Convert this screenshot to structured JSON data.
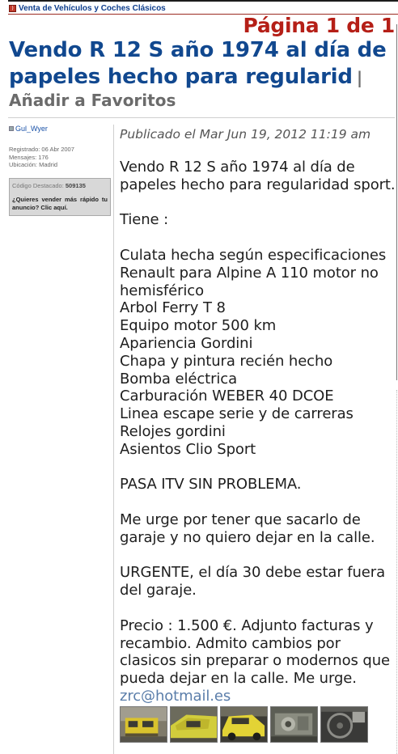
{
  "breadcrumb": {
    "label": "Venta de Vehículos y Coches Clásicos",
    "icon": "rss-icon"
  },
  "pagination": {
    "text": "Página 1 de 1"
  },
  "topic": {
    "title": "Vendo R 12 S año 1974 al día de papeles hecho para regularid",
    "favorite_link": "| Añadir a Favoritos"
  },
  "author": {
    "username": "Gul_Wyer",
    "registered": "Registrado: 06 Abr 2007",
    "posts": "Mensajes: 176",
    "location": "Ubicación: Madrid"
  },
  "promo": {
    "code_label": "Código Destacado:",
    "code_value": "509135",
    "link": "¿Quieres vender más rápido tu anuncio? Clic aquí."
  },
  "post": {
    "date": "Publicado el Mar Jun 19, 2012 11:19 am",
    "intro": "Vendo R 12 S año 1974 al día de papeles hecho para regularidad sport.",
    "tiene": "Tiene :",
    "features": [
      "Culata hecha según especificaciones Renault para Alpine A 110 motor no hemisférico",
      "Arbol Ferry T 8",
      "Equipo motor 500 km",
      "Apariencia Gordini",
      "Chapa y pintura recién hecho",
      "Bomba eléctrica",
      "Carburación WEBER 40 DCOE",
      "Linea escape serie y de carreras",
      "Relojes gordini",
      "Asientos Clio Sport"
    ],
    "itv": "PASA ITV SIN PROBLEMA.",
    "urge": "Me urge por tener que sacarlo de garaje y no quiero dejar en la calle.",
    "urgente": "URGENTE, el día 30 debe estar fuera del garaje.",
    "price": "Precio : 1.500 €. Adjunto facturas y recambio. Admito cambios por clasicos sin preparar o modernos que pueda dejar en la calle. Me urge.",
    "email": "zrc@hotmail.es"
  },
  "colors": {
    "title": "#11488f",
    "pagination": "#b51f17",
    "link": "#1a52a8"
  }
}
